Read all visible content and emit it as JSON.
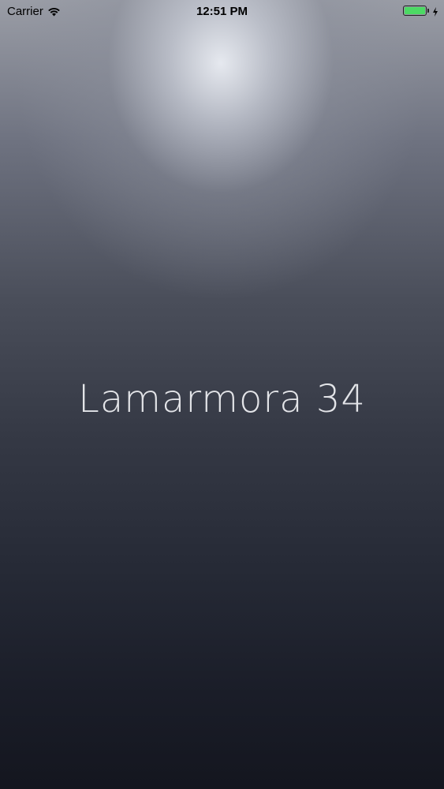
{
  "status_bar": {
    "carrier": "Carrier",
    "time": "12:51 PM",
    "battery_level": 1.0,
    "battery_color": "#4cd964",
    "icons": [
      "wifi-icon",
      "battery-icon",
      "charging-bolt-icon"
    ]
  },
  "main": {
    "title": "Lamarmora 34"
  }
}
